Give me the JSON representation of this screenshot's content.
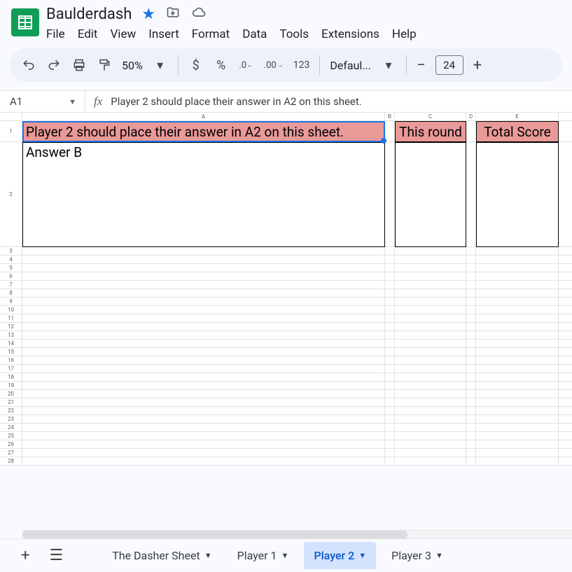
{
  "doc": {
    "title": "Baulderdash"
  },
  "menubar": [
    "File",
    "Edit",
    "View",
    "Insert",
    "Format",
    "Data",
    "Tools",
    "Extensions",
    "Help"
  ],
  "toolbar": {
    "zoom": "50%",
    "currency": "$",
    "percent": "%",
    "dec_dec": ".0",
    "dec_inc": ".00",
    "num_fmt": "123",
    "font": "Defaul...",
    "font_size": "24"
  },
  "formula": {
    "cell_ref": "A1",
    "fx": "fx",
    "value": "Player 2 should place their answer in A2 on this sheet."
  },
  "columns": [
    "A",
    "B",
    "C",
    "D",
    "E"
  ],
  "cells": {
    "A1": "Player 2 should place their answer in A2 on this sheet.",
    "C1": "This round",
    "E1": "Total Score",
    "A2": "Answer B"
  },
  "row_numbers_tall": [
    "1",
    "2"
  ],
  "row_numbers_small": [
    "3",
    "4",
    "5",
    "6",
    "7",
    "8",
    "9",
    "10",
    "11",
    "12",
    "13",
    "14",
    "15",
    "16",
    "17",
    "18",
    "19",
    "20",
    "21",
    "22",
    "23",
    "24",
    "25",
    "26",
    "27",
    "28"
  ],
  "sheet_tabs": {
    "items": [
      {
        "label": "The Dasher Sheet",
        "active": false
      },
      {
        "label": "Player 1",
        "active": false
      },
      {
        "label": "Player 2",
        "active": true
      },
      {
        "label": "Player 3",
        "active": false
      }
    ]
  }
}
